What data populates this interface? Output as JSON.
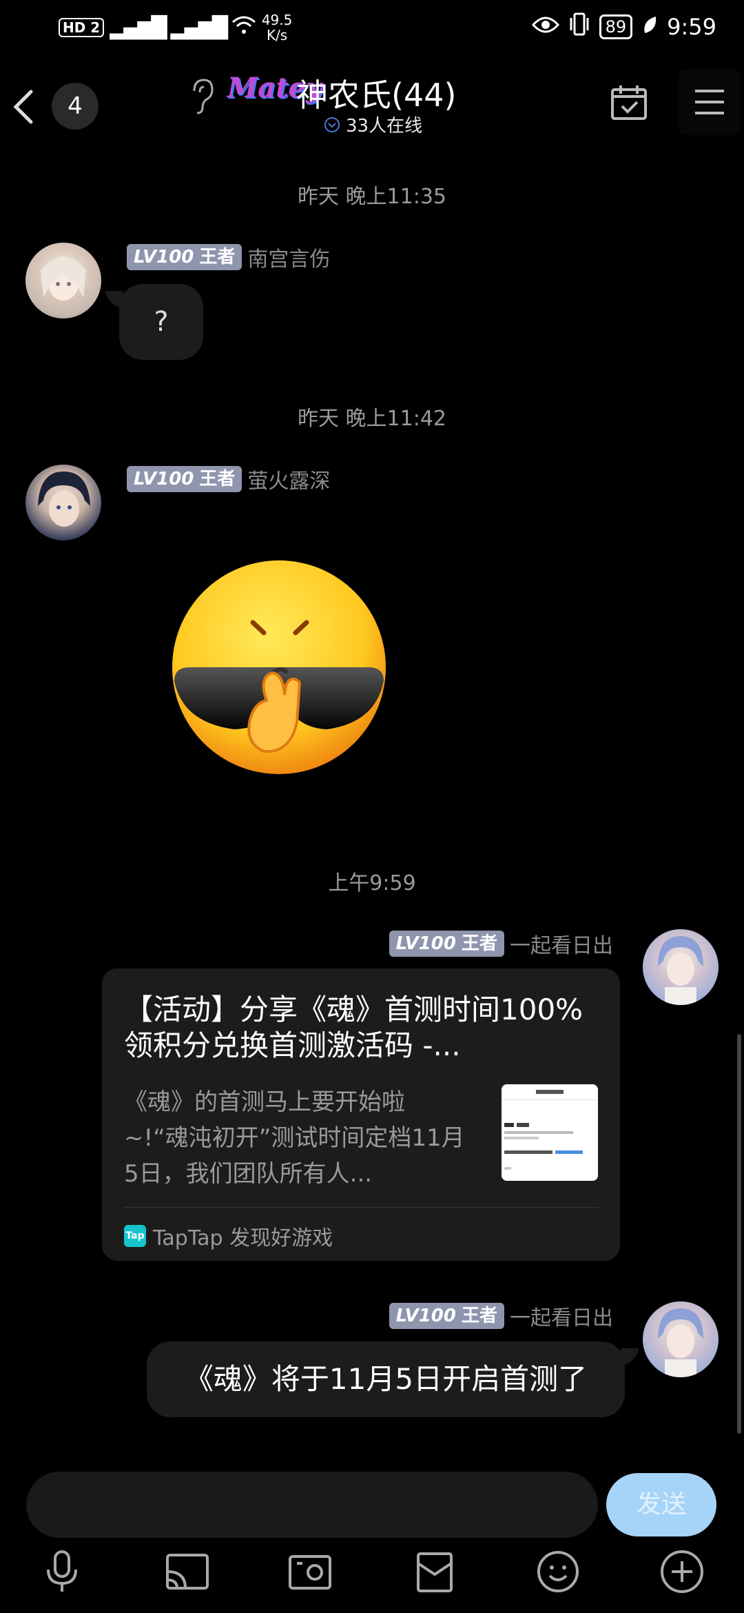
{
  "status_bar": {
    "network": "HD 2",
    "signal1": "4G",
    "signal2": "4G",
    "speed_value": "49.5",
    "speed_unit": "K/s",
    "battery": "89",
    "time": "9:59"
  },
  "header": {
    "unread_count": "4",
    "logo_text": "Matey",
    "group_name": "神农氏(44)",
    "online": "33人在线"
  },
  "messages": {
    "ts1": "昨天 晚上11:35",
    "m1": {
      "level": "LV100",
      "rank": "王者",
      "sender": "南宫言伤",
      "text": "?"
    },
    "ts2": "昨天 晚上11:42",
    "m2": {
      "level": "LV100",
      "rank": "王者",
      "sender": "萤火露深"
    },
    "ts3": "上午9:59",
    "m3": {
      "level": "LV100",
      "rank": "王者",
      "sender": "一起看日出",
      "card_title": "【活动】分享《魂》首测时间100%领积分兑换首测激活码 -...",
      "card_desc": "《魂》的首测马上要开始啦~!“魂沌初开”测试时间定档11月5日，我们团队所有人...",
      "card_source": "TapTap 发现好游戏",
      "tap_logo": "Tap"
    },
    "m4": {
      "level": "LV100",
      "rank": "王者",
      "sender": "一起看日出",
      "text": "《魂》将于11月5日开启首测了"
    }
  },
  "input": {
    "placeholder": "",
    "send_label": "发送"
  },
  "icons": {
    "toolbar": [
      "microphone-icon",
      "cast-icon",
      "photo-icon",
      "gift-box-icon",
      "emoji-icon",
      "plus-icon"
    ]
  },
  "colors": {
    "background": "#000000",
    "bubble": "#1c1c1c",
    "level_badge": "#8e95ad",
    "send_button": "#a6d3f8"
  }
}
